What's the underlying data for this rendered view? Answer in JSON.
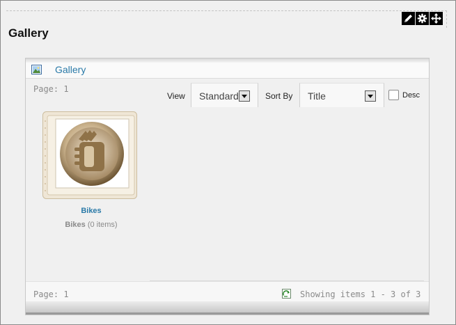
{
  "page": {
    "title": "Gallery"
  },
  "toolbar_icons": [
    "pencil-icon",
    "gear-icon",
    "move-icon"
  ],
  "panel": {
    "header_link": "Gallery",
    "header_icon": "picture-icon",
    "page_label_top": "Page: 1",
    "view_label": "View",
    "view_value": "Standard",
    "sort_label": "Sort By",
    "sort_value": "Title",
    "desc_label": "Desc",
    "desc_checked": false
  },
  "items": [
    {
      "title": "Bikes",
      "name": "Bikes",
      "count": "(0 items)"
    }
  ],
  "footer": {
    "page_label": "Page: 1",
    "showing": "Showing items 1 - 3 of 3",
    "refresh_icon": "refresh-icon"
  }
}
